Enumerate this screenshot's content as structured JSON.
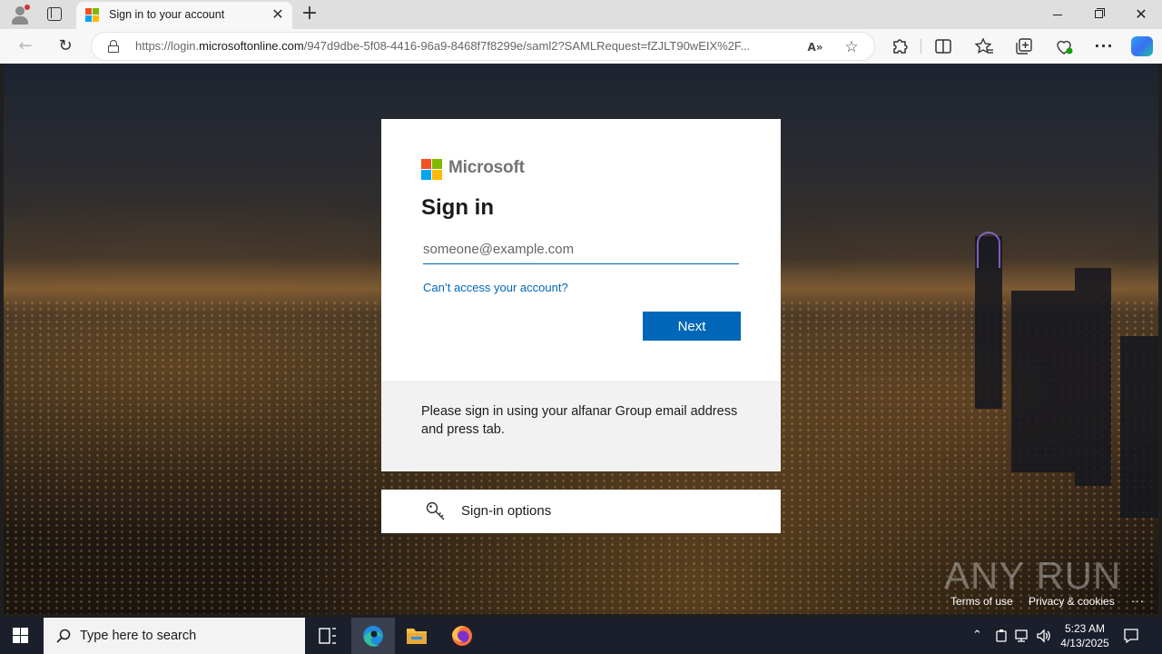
{
  "browser": {
    "tab": {
      "title": "Sign in to your account",
      "close_glyph": "✕"
    },
    "newtab_glyph": "+",
    "address": {
      "host_prefix": "https://login.",
      "host": "microsoftonline.com",
      "path": "/947d9dbe-5f08-4416-96a9-8468f7f8299e/saml2?SAMLRequest=fZJLT90wEIX%2F..."
    },
    "icons": [
      "profile-icon",
      "tab-actions-icon",
      "back-icon",
      "reload-icon",
      "lock-icon",
      "read-aloud-icon",
      "favorite-star-icon",
      "extensions-icon",
      "split-screen-icon",
      "favorites-icon",
      "collections-icon",
      "browser-essentials-icon",
      "more-icon",
      "copilot-icon"
    ]
  },
  "signin": {
    "brand": "Microsoft",
    "title": "Sign in",
    "email_placeholder": "someone@example.com",
    "cant_access": "Can’t access your account?",
    "next_label": "Next",
    "notice": "Please sign in using your alfanar Group email address and press tab.",
    "options_label": "Sign-in options"
  },
  "footer": {
    "terms": "Terms of use",
    "privacy": "Privacy & cookies",
    "more": "..."
  },
  "watermark": "ANY RUN",
  "taskbar": {
    "search_placeholder": "Type here to search",
    "time": "5:23 AM",
    "date": "4/13/2025"
  },
  "colors": {
    "accent": "#0067b8",
    "ms_red": "#f25022",
    "ms_green": "#7fba00",
    "ms_blue": "#00a4ef",
    "ms_yellow": "#ffb900"
  }
}
